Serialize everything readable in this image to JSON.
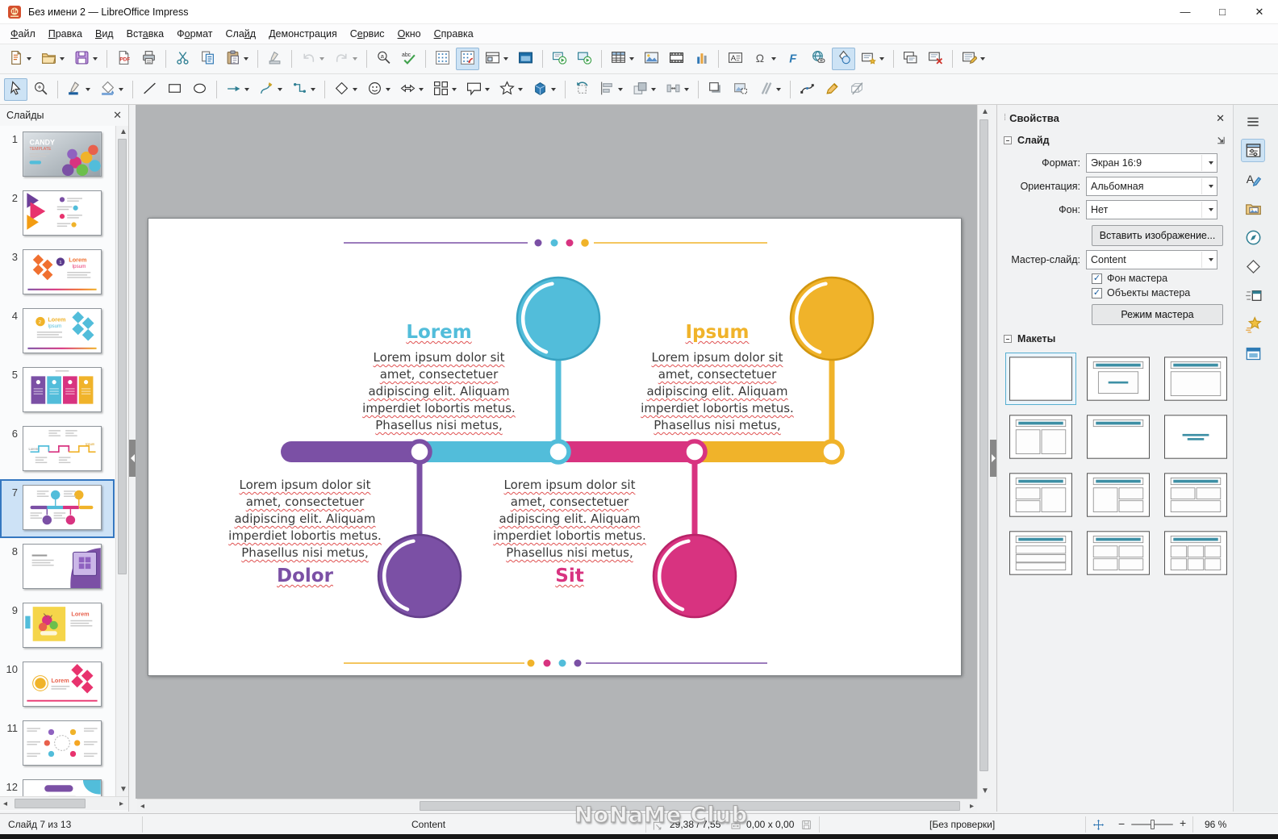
{
  "window": {
    "title": "Без имени 2 — LibreOffice Impress"
  },
  "menubar": {
    "items": [
      {
        "label": "Файл",
        "u": 0
      },
      {
        "label": "Правка",
        "u": 0
      },
      {
        "label": "Вид",
        "u": 0
      },
      {
        "label": "Вставка",
        "u": 3
      },
      {
        "label": "Формат",
        "u": 1
      },
      {
        "label": "Слайд",
        "u": 3
      },
      {
        "label": "Демонстрация",
        "u": 0
      },
      {
        "label": "Сервис",
        "u": 1
      },
      {
        "label": "Окно",
        "u": 0
      },
      {
        "label": "Справка",
        "u": 0
      }
    ]
  },
  "toolbars": {
    "main": [
      {
        "i": "new",
        "dd": 1
      },
      {
        "i": "open",
        "dd": 1
      },
      {
        "i": "save",
        "dd": 1
      },
      "|",
      {
        "i": "export-pdf"
      },
      {
        "i": "print"
      },
      "|",
      {
        "i": "cut"
      },
      {
        "i": "copy"
      },
      {
        "i": "paste",
        "dd": 1
      },
      "|",
      {
        "i": "clone-formatting"
      },
      "|",
      {
        "i": "undo",
        "dd": 1,
        "dis": 1
      },
      {
        "i": "redo",
        "dd": 1,
        "dis": 1
      },
      "|",
      {
        "i": "find-replace"
      },
      {
        "i": "spelling"
      },
      "|",
      {
        "i": "display-grid"
      },
      {
        "i": "snap-grid",
        "act": 1
      },
      {
        "i": "display-views",
        "dd": 1
      },
      {
        "i": "master-view"
      },
      "|",
      {
        "i": "start-first-slide"
      },
      {
        "i": "start-current-slide"
      },
      "|",
      {
        "i": "insert-table",
        "dd": 1
      },
      {
        "i": "insert-image"
      },
      {
        "i": "insert-media"
      },
      {
        "i": "insert-chart"
      },
      "|",
      {
        "i": "insert-textbox"
      },
      {
        "i": "special-char",
        "dd": 1
      },
      {
        "i": "fontwork"
      },
      {
        "i": "hyperlink"
      },
      {
        "i": "draw-functions",
        "act": 1
      },
      {
        "i": "insert-slide",
        "dd": 1
      },
      "|",
      {
        "i": "duplicate-slide"
      },
      {
        "i": "delete-slide"
      },
      "|",
      {
        "i": "slide-properties",
        "dd": 1
      }
    ],
    "draw": [
      {
        "i": "select",
        "act": 1
      },
      {
        "i": "zoom"
      },
      "|",
      {
        "i": "line-color",
        "dd": 1
      },
      {
        "i": "fill-color",
        "dd": 1
      },
      "|",
      {
        "i": "line"
      },
      {
        "i": "rectangle"
      },
      {
        "i": "ellipse"
      },
      "|",
      {
        "i": "lines-arrows",
        "dd": 1
      },
      {
        "i": "curves",
        "dd": 1
      },
      {
        "i": "connectors",
        "dd": 1
      },
      "|",
      {
        "i": "basic-shapes",
        "dd": 1
      },
      {
        "i": "symbol-shapes",
        "dd": 1
      },
      {
        "i": "block-arrows",
        "dd": 1
      },
      {
        "i": "flowchart",
        "dd": 1
      },
      {
        "i": "callouts",
        "dd": 1
      },
      {
        "i": "stars",
        "dd": 1
      },
      {
        "i": "3d-objects",
        "dd": 1
      },
      "|",
      {
        "i": "rotate"
      },
      {
        "i": "align",
        "dd": 1
      },
      {
        "i": "arrange",
        "dd": 1
      },
      {
        "i": "distribute",
        "dd": 1
      },
      "|",
      {
        "i": "shadow"
      },
      {
        "i": "crop-image"
      },
      {
        "i": "filter",
        "dd": 1
      },
      "|",
      {
        "i": "edit-points"
      },
      {
        "i": "glue-points"
      },
      {
        "i": "toggle-extrusion"
      }
    ]
  },
  "slides_panel": {
    "title": "Слайды",
    "selected": 7,
    "slides": [
      {
        "num": 1,
        "kind": "candy-photo"
      },
      {
        "num": 2,
        "kind": "color-arrows"
      },
      {
        "num": 3,
        "kind": "orange-diamonds"
      },
      {
        "num": 4,
        "kind": "blue-diamonds"
      },
      {
        "num": 5,
        "kind": "four-panels"
      },
      {
        "num": 6,
        "kind": "zigzag-timeline"
      },
      {
        "num": 7,
        "kind": "circle-timeline"
      },
      {
        "num": 8,
        "kind": "gift-purple"
      },
      {
        "num": 9,
        "kind": "candy-yellow"
      },
      {
        "num": 10,
        "kind": "pink-diamonds"
      },
      {
        "num": 11,
        "kind": "circle-diagram"
      },
      {
        "num": 12,
        "kind": "purple-title"
      }
    ]
  },
  "properties_panel": {
    "title": "Свойства",
    "slide_section": {
      "title": "Слайд",
      "format_label": "Формат:",
      "format_value": "Экран 16:9",
      "orientation_label": "Ориентация:",
      "orientation_value": "Альбомная",
      "background_label": "Фон:",
      "background_value": "Нет",
      "insert_image_button": "Вставить изображение...",
      "master_label": "Мастер-слайд:",
      "master_value": "Content",
      "master_bg_checkbox": "Фон мастера",
      "master_objects_checkbox": "Объекты мастера",
      "master_mode_button": "Режим мастера"
    },
    "layouts_section": {
      "title": "Макеты",
      "selected_index": 0,
      "count": 12
    }
  },
  "sidebar_tabs": [
    {
      "name": "properties",
      "active": true
    },
    {
      "name": "styles"
    },
    {
      "name": "gallery"
    },
    {
      "name": "navigator"
    },
    {
      "name": "shapes"
    },
    {
      "name": "slide-transition"
    },
    {
      "name": "animation"
    },
    {
      "name": "master-slides"
    }
  ],
  "statusbar": {
    "slide_info": "Слайд 7 из 13",
    "master": "Content",
    "position": "29,38 / 7,55",
    "object_size": "0,00 x 0,00",
    "proofing": "[Без проверки]",
    "zoom_percent": "96 %",
    "zoom_slider_pos": 0.46
  },
  "watermark": "NoNaMe Club",
  "palette": {
    "purple": "#7b50a5",
    "cyan": "#52bdda",
    "pink": "#d83380",
    "yellow": "#f0b32a",
    "purple_dark": "#66408c",
    "cyan_dark": "#39a3c2",
    "pink_dark": "#b92368",
    "yellow_dark": "#d2960f"
  },
  "slide": {
    "sections": [
      {
        "title": "Lorem",
        "color_key": "cyan",
        "body": "Lorem ipsum dolor sit amet, consectetuer adipiscing elit. Aliquam imperdiet lobortis metus. Phasellus nisi metus,"
      },
      {
        "title": "Ipsum",
        "color_key": "yellow",
        "body": "Lorem ipsum dolor sit amet, consectetuer adipiscing elit. Aliquam imperdiet lobortis metus. Phasellus nisi metus,"
      },
      {
        "title": "Dolor",
        "color_key": "purple",
        "body": "Lorem ipsum dolor sit amet, consectetuer adipiscing elit. Aliquam imperdiet lobortis metus. Phasellus nisi metus,"
      },
      {
        "title": "Sit",
        "color_key": "pink",
        "body": "Lorem ipsum dolor sit amet, consectetuer adipiscing elit. Aliquam imperdiet lobortis metus. Phasellus nisi metus,"
      }
    ]
  }
}
